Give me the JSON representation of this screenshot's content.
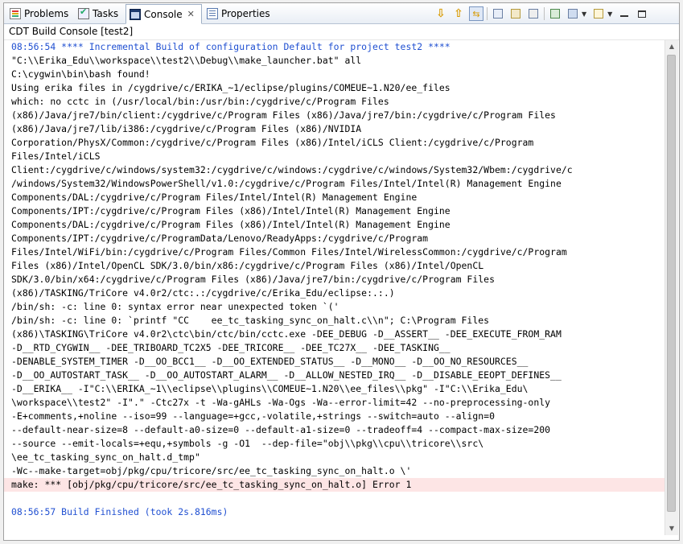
{
  "tabs": [
    {
      "label": "Problems",
      "icon": "problems-icon"
    },
    {
      "label": "Tasks",
      "icon": "tasks-icon"
    },
    {
      "label": "Console",
      "icon": "console-icon",
      "close": "✕"
    },
    {
      "label": "Properties",
      "icon": "properties-icon"
    }
  ],
  "console_title": "CDT Build Console [test2]",
  "lines": [
    {
      "text": "08:56:54 **** Incremental Build of configuration Default for project test2 ****",
      "style": "blue"
    },
    {
      "text": "\"C:\\\\Erika_Edu\\\\workspace\\\\test2\\\\Debug\\\\make_launcher.bat\" all",
      "style": ""
    },
    {
      "text": "C:\\cygwin\\bin\\bash found!",
      "style": ""
    },
    {
      "text": "Using erika files in /cygdrive/c/ERIKA_~1/eclipse/plugins/COMEUE~1.N20/ee_files",
      "style": ""
    },
    {
      "text": "which: no cctc in (/usr/local/bin:/usr/bin:/cygdrive/c/Program Files",
      "style": ""
    },
    {
      "text": "(x86)/Java/jre7/bin/client:/cygdrive/c/Program Files (x86)/Java/jre7/bin:/cygdrive/c/Program Files",
      "style": ""
    },
    {
      "text": "(x86)/Java/jre7/lib/i386:/cygdrive/c/Program Files (x86)/NVIDIA",
      "style": ""
    },
    {
      "text": "Corporation/PhysX/Common:/cygdrive/c/Program Files (x86)/Intel/iCLS Client:/cygdrive/c/Program",
      "style": ""
    },
    {
      "text": "Files/Intel/iCLS",
      "style": ""
    },
    {
      "text": "Client:/cygdrive/c/windows/system32:/cygdrive/c/windows:/cygdrive/c/windows/System32/Wbem:/cygdrive/c",
      "style": ""
    },
    {
      "text": "/windows/System32/WindowsPowerShell/v1.0:/cygdrive/c/Program Files/Intel/Intel(R) Management Engine",
      "style": ""
    },
    {
      "text": "Components/DAL:/cygdrive/c/Program Files/Intel/Intel(R) Management Engine",
      "style": ""
    },
    {
      "text": "Components/IPT:/cygdrive/c/Program Files (x86)/Intel/Intel(R) Management Engine",
      "style": ""
    },
    {
      "text": "Components/DAL:/cygdrive/c/Program Files (x86)/Intel/Intel(R) Management Engine",
      "style": ""
    },
    {
      "text": "Components/IPT:/cygdrive/c/ProgramData/Lenovo/ReadyApps:/cygdrive/c/Program",
      "style": ""
    },
    {
      "text": "Files/Intel/WiFi/bin:/cygdrive/c/Program Files/Common Files/Intel/WirelessCommon:/cygdrive/c/Program",
      "style": ""
    },
    {
      "text": "Files (x86)/Intel/OpenCL SDK/3.0/bin/x86:/cygdrive/c/Program Files (x86)/Intel/OpenCL",
      "style": ""
    },
    {
      "text": "SDK/3.0/bin/x64:/cygdrive/c/Program Files (x86)/Java/jre7/bin:/cygdrive/c/Program Files",
      "style": ""
    },
    {
      "text": "(x86)/TASKING/TriCore v4.0r2/ctc:.:/cygdrive/c/Erika_Edu/eclipse:.:.)",
      "style": ""
    },
    {
      "text": "/bin/sh: -c: line 0: syntax error near unexpected token `('",
      "style": ""
    },
    {
      "text": "/bin/sh: -c: line 0: `printf \"CC    ee_tc_tasking_sync_on_halt.c\\\\n\"; C:\\Program Files",
      "style": ""
    },
    {
      "text": "(x86)\\TASKING\\TriCore v4.0r2\\ctc\\bin/ctc/bin/cctc.exe -DEE_DEBUG -D__ASSERT__ -DEE_EXECUTE_FROM_RAM",
      "style": ""
    },
    {
      "text": "-D__RTD_CYGWIN__ -DEE_TRIBOARD_TC2X5 -DEE_TRICORE__ -DEE_TC27X__ -DEE_TASKING__",
      "style": ""
    },
    {
      "text": "-DENABLE_SYSTEM_TIMER -D__OO_BCC1__ -D__OO_EXTENDED_STATUS__ -D__MONO__ -D__OO_NO_RESOURCES__",
      "style": ""
    },
    {
      "text": "-D__OO_AUTOSTART_TASK__ -D__OO_AUTOSTART_ALARM__ -D__ALLOW_NESTED_IRQ__ -D__DISABLE_EEOPT_DEFINES__",
      "style": ""
    },
    {
      "text": "-D__ERIKA__ -I\"C:\\\\ERIKA_~1\\\\eclipse\\\\plugins\\\\COMEUE~1.N20\\\\ee_files\\\\pkg\" -I\"C:\\\\Erika_Edu\\",
      "style": ""
    },
    {
      "text": "\\workspace\\\\test2\" -I\".\" -Ctc27x -t -Wa-gAHLs -Wa-Ogs -Wa--error-limit=42 --no-preprocessing-only",
      "style": ""
    },
    {
      "text": "-E+comments,+noline --iso=99 --language=+gcc,-volatile,+strings --switch=auto --align=0",
      "style": ""
    },
    {
      "text": "--default-near-size=8 --default-a0-size=0 --default-a1-size=0 --tradeoff=4 --compact-max-size=200",
      "style": ""
    },
    {
      "text": "--source --emit-locals=+equ,+symbols -g -O1  --dep-file=\"obj\\\\pkg\\\\cpu\\\\tricore\\\\src\\",
      "style": ""
    },
    {
      "text": "\\ee_tc_tasking_sync_on_halt.d_tmp\"",
      "style": ""
    },
    {
      "text": "-Wc--make-target=obj/pkg/cpu/tricore/src/ee_tc_tasking_sync_on_halt.o \\'",
      "style": ""
    },
    {
      "text": "make: *** [obj/pkg/cpu/tricore/src/ee_tc_tasking_sync_on_halt.o] Error 1",
      "style": "err"
    },
    {
      "text": "",
      "style": ""
    },
    {
      "text": "08:56:57 Build Finished (took 2s.816ms)",
      "style": "blue"
    }
  ],
  "toolbar_icons": [
    "scroll-down-icon",
    "scroll-up-icon",
    "scroll-lock-icon",
    "clear-console-icon",
    "pin-console-icon",
    "remove-launch-icon",
    "display-selected-console-icon",
    "open-console-icon",
    "new-console-icon",
    "view-menu-icon"
  ]
}
